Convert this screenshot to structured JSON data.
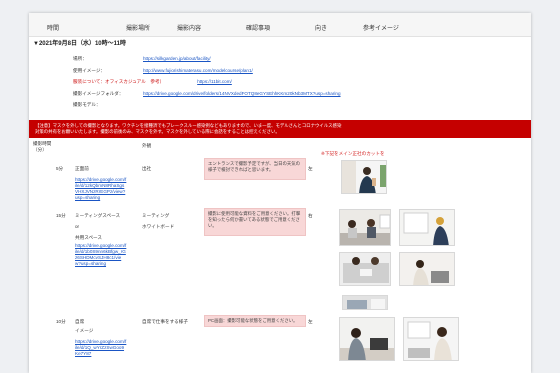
{
  "header": {
    "time": "時間",
    "place": "撮影場所",
    "content": "撮影内容",
    "check": "確認事項",
    "direction": "向き",
    "reference": "参考イメージ"
  },
  "date_row": "▼2021年9月8日（水）10時～11時",
  "info": {
    "place_label": "場所：",
    "place_url": "https://silkgarden.jp/about/facility/",
    "usage_label": "使用イメージ：",
    "usage_url": "http://www.fujiorishimaterasu.com/modelcourse/plan1/",
    "dress_label": "服装について：オフィスカジュアル　参考）",
    "dress_url": "https://11bit.com/",
    "folder_label": "撮影イメージフォルダ：",
    "folder_url": "https://drive.google.com/drive/folders/14NVXdedFOTQ8eGYSEhhKKm20kNb3MTX?usp=sharing",
    "model_label": "撮影モデル："
  },
  "notice": {
    "line1": "【注意】マスクを外しての撮影となります。ワクチンを接種済でもブレークスルー感染例などもありますので、いま一度、モデルさんとコロナウイルス感染",
    "line2": "対策の共有をお願いいたします。撮影の前後のみ、マスクを外す。マスクを外している際に会話をすることは控えください。"
  },
  "table": {
    "col_time": "撮影時間\n（分）",
    "col_exterior": "外観",
    "note_red": "※下記をメイン正社のカットを"
  },
  "rows": [
    {
      "time": "5分",
      "place": "正面前",
      "url": "https://drive.google.com/file/d/12kQbmN8RhaSgsVHXJVNzRrEGPz/view?usp=sharing",
      "content": "出社",
      "note": "エントランスで撮影予定ですが、当日の天気の様子で検討できればと思います。",
      "direction": "左"
    },
    {
      "time": "15分",
      "place": "ミーティングスペース",
      "place_or": "or",
      "place2": "共用スペース",
      "url": "https://drive.google.com/file/d/1b0S9nn6kBfgw_rGz6SHDMcvSJH8c1/view?usp=sharing",
      "content": "ミーティング",
      "content2": "ホワイトボード",
      "note": "撮影に使用可能な資料をご用意ください。打撃を知ったら何か書いてある状態でご用意ください。",
      "direction": "右"
    },
    {
      "time": "10分",
      "place": "自席",
      "place2": "イメージ",
      "url": "https://drive.google.com/file/d/1Q_wYrZzSwGoo9Ke7Y87",
      "content": "自席で仕事をする様子",
      "note": "PC画面：撮影可能な状態をご用意ください。",
      "direction": "左"
    }
  ],
  "colors": {
    "notice_bg": "#c50000",
    "link": "#1a55c4",
    "note_bg": "#f8d7d7"
  }
}
